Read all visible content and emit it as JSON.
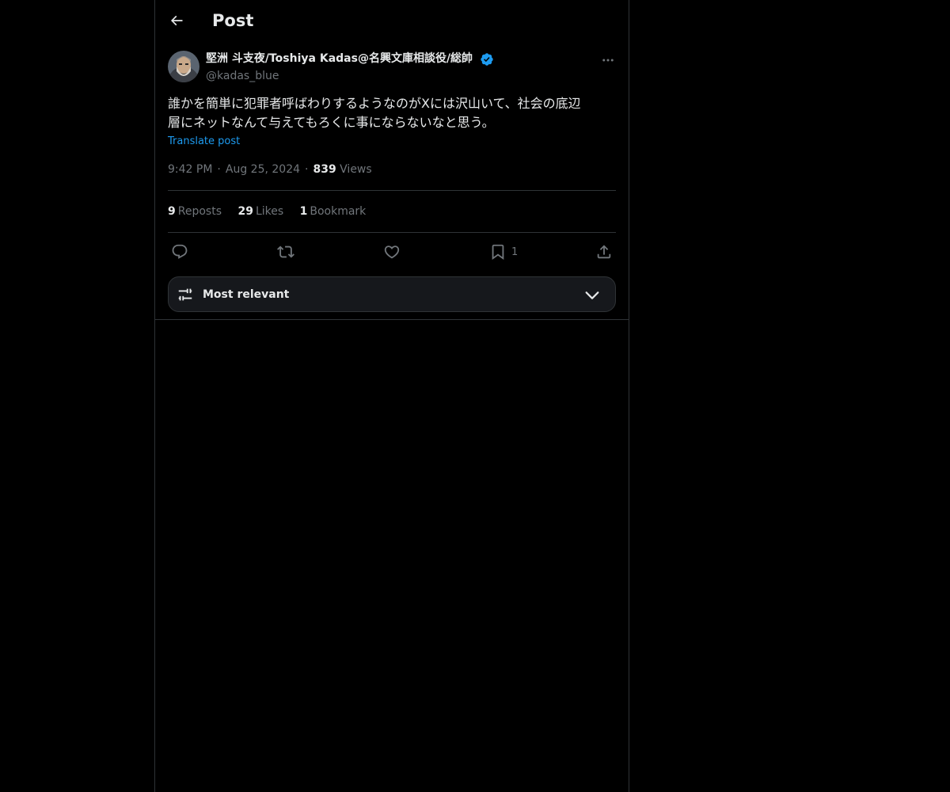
{
  "header": {
    "title": "Post",
    "back_icon": "arrow-left-icon"
  },
  "author": {
    "display_name": "堅洲 斗支夜/Toshiya Kadas@名興文庫相談役/総帥",
    "handle": "@kadas_blue",
    "verified": true,
    "verified_color": "#1d9bf0"
  },
  "post": {
    "text_line1": "誰かを簡単に犯罪者呼ばわりするようなのがXには沢山いて、社会の底辺",
    "text_line2": "層にネットなんて与えてもろくに事にならないなと思う。",
    "translate_label": "Translate post",
    "time": "9:42 PM",
    "date": "Aug 25, 2024",
    "views_count": "839",
    "views_label": "Views"
  },
  "stats": {
    "reposts_count": "9",
    "reposts_label": "Reposts",
    "likes_count": "29",
    "likes_label": "Likes",
    "bookmarks_count": "1",
    "bookmarks_label": "Bookmark"
  },
  "actions": {
    "reply_icon": "reply-icon",
    "repost_icon": "repost-icon",
    "like_icon": "heart-icon",
    "bookmark_icon": "bookmark-icon",
    "bookmark_count": "1",
    "share_icon": "share-icon"
  },
  "sort": {
    "label": "Most relevant",
    "icon": "sliders-icon"
  },
  "colors": {
    "background": "#000000",
    "text": "#e7e9ea",
    "secondary": "#71767b",
    "accent": "#1d9bf0",
    "border": "#2f3336"
  }
}
